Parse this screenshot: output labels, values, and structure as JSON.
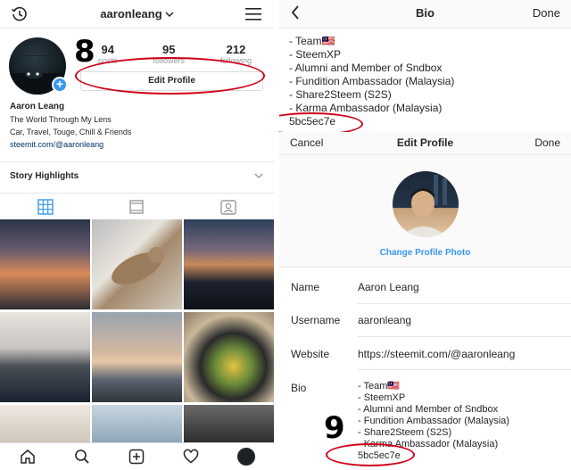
{
  "profile": {
    "username": "aaronleang",
    "annotation_number": "8",
    "stats": [
      {
        "value": "94",
        "label": "posts"
      },
      {
        "value": "95",
        "label": "followers"
      },
      {
        "value": "212",
        "label": "following"
      }
    ],
    "edit_profile_label": "Edit Profile",
    "name": "Aaron Leang",
    "bio_lines": [
      "The World Through My Lens",
      "Car, Travel, Touge, Chill & Friends"
    ],
    "link": "steemit.com/@aaronleang",
    "story_highlights_label": "Story Highlights"
  },
  "bio_view": {
    "title": "Bio",
    "done_label": "Done",
    "lines": [
      "- Team🇲🇾",
      "- SteemXP",
      "- Alumni and Member of Sndbox",
      "- Fundition Ambassador (Malaysia)",
      "- Share2Steem (S2S)",
      "- Karma Ambassador (Malaysia)",
      "5bc5ec7e"
    ]
  },
  "edit_profile": {
    "cancel_label": "Cancel",
    "title": "Edit Profile",
    "done_label": "Done",
    "change_photo_label": "Change Profile Photo",
    "fields": [
      {
        "label": "Name",
        "value": "Aaron Leang"
      },
      {
        "label": "Username",
        "value": "aaronleang"
      },
      {
        "label": "Website",
        "value": "https://steemit.com/@aaronleang"
      }
    ],
    "bio_label": "Bio",
    "bio_lines": [
      "- Team🇲🇾",
      "- SteemXP",
      "- Alumni and Member of Sndbox",
      "- Fundition Ambassador (Malaysia)",
      "- Share2Steem (S2S)",
      "- Karma Ambassador (Malaysia)",
      "5bc5ec7e"
    ],
    "annotation_number": "9"
  },
  "colors": {
    "accent": "#3897f0",
    "annotation_red": "#d0021b",
    "link": "#003569"
  },
  "icons": {
    "top_left": "history-icon",
    "top_right": "hamburger-menu-icon",
    "tabs": [
      "grid-icon",
      "feed-icon",
      "tagged-icon"
    ],
    "bottom_nav": [
      "home-icon",
      "search-icon",
      "add-post-icon",
      "heart-icon",
      "profile-avatar-icon"
    ]
  }
}
